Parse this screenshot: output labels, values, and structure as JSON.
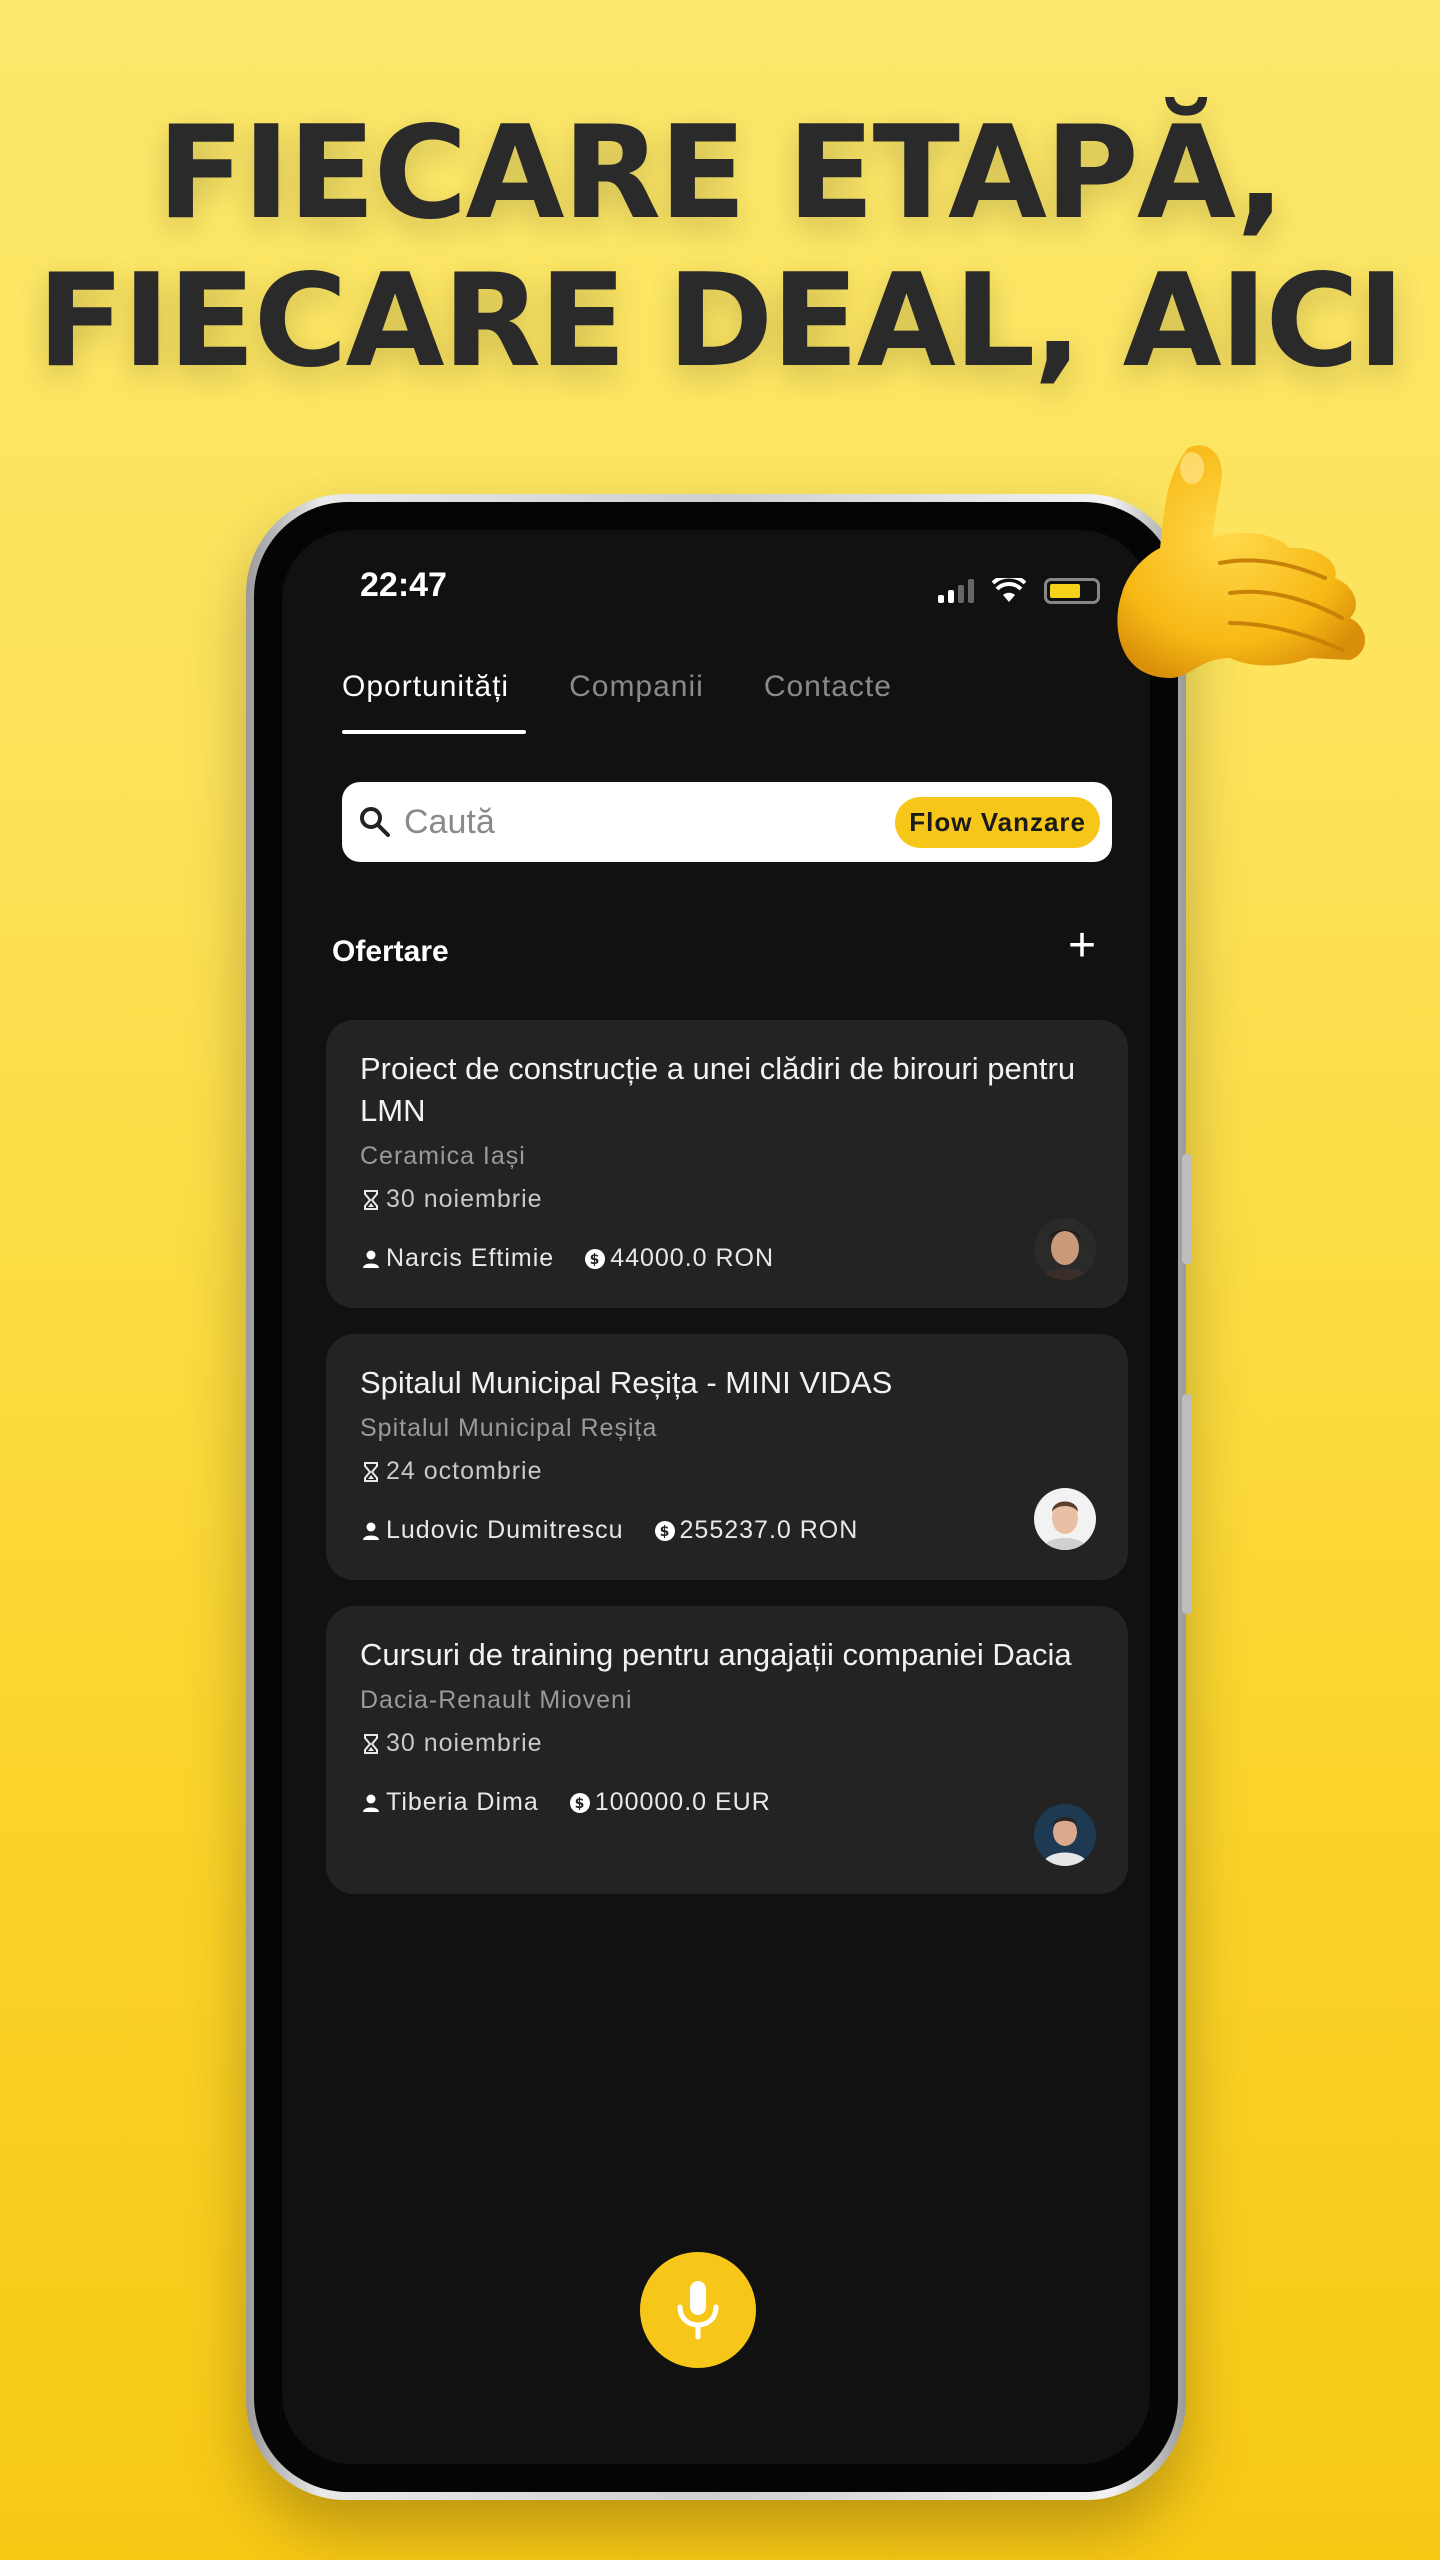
{
  "headline": {
    "line1": "FIECARE ETAPĂ,",
    "line2": "FIECARE DEAL, AICI"
  },
  "status_bar": {
    "time": "22:47"
  },
  "tabs": [
    {
      "label": "Oportunități",
      "active": true
    },
    {
      "label": "Companii",
      "active": false
    },
    {
      "label": "Contacte",
      "active": false
    }
  ],
  "search": {
    "placeholder": "Caută",
    "value": "",
    "flow_label": "Flow Vanzare"
  },
  "section": {
    "title": "Ofertare",
    "add_icon": "plus-icon"
  },
  "deals": [
    {
      "title": "Proiect de construcție a unei clădiri de birouri pentru LMN",
      "company": "Ceramica Iași",
      "date": "30 noiembrie",
      "owner": "Narcis Eftimie",
      "amount": "44000.0 RON"
    },
    {
      "title": "Spitalul Municipal Reșița - MINI VIDAS",
      "company": "Spitalul Municipal Reșița",
      "date": "24 octombrie",
      "owner": "Ludovic Dumitrescu",
      "amount": "255237.0 RON"
    },
    {
      "title": "Cursuri de training pentru angajații companiei Dacia",
      "company": "Dacia-Renault Mioveni",
      "date": "30 noiembrie",
      "owner": "Tiberia Dima",
      "amount": "100000.0 EUR"
    }
  ],
  "colors": {
    "accent": "#f6c718",
    "background_dark": "#111111",
    "card": "#232323"
  }
}
